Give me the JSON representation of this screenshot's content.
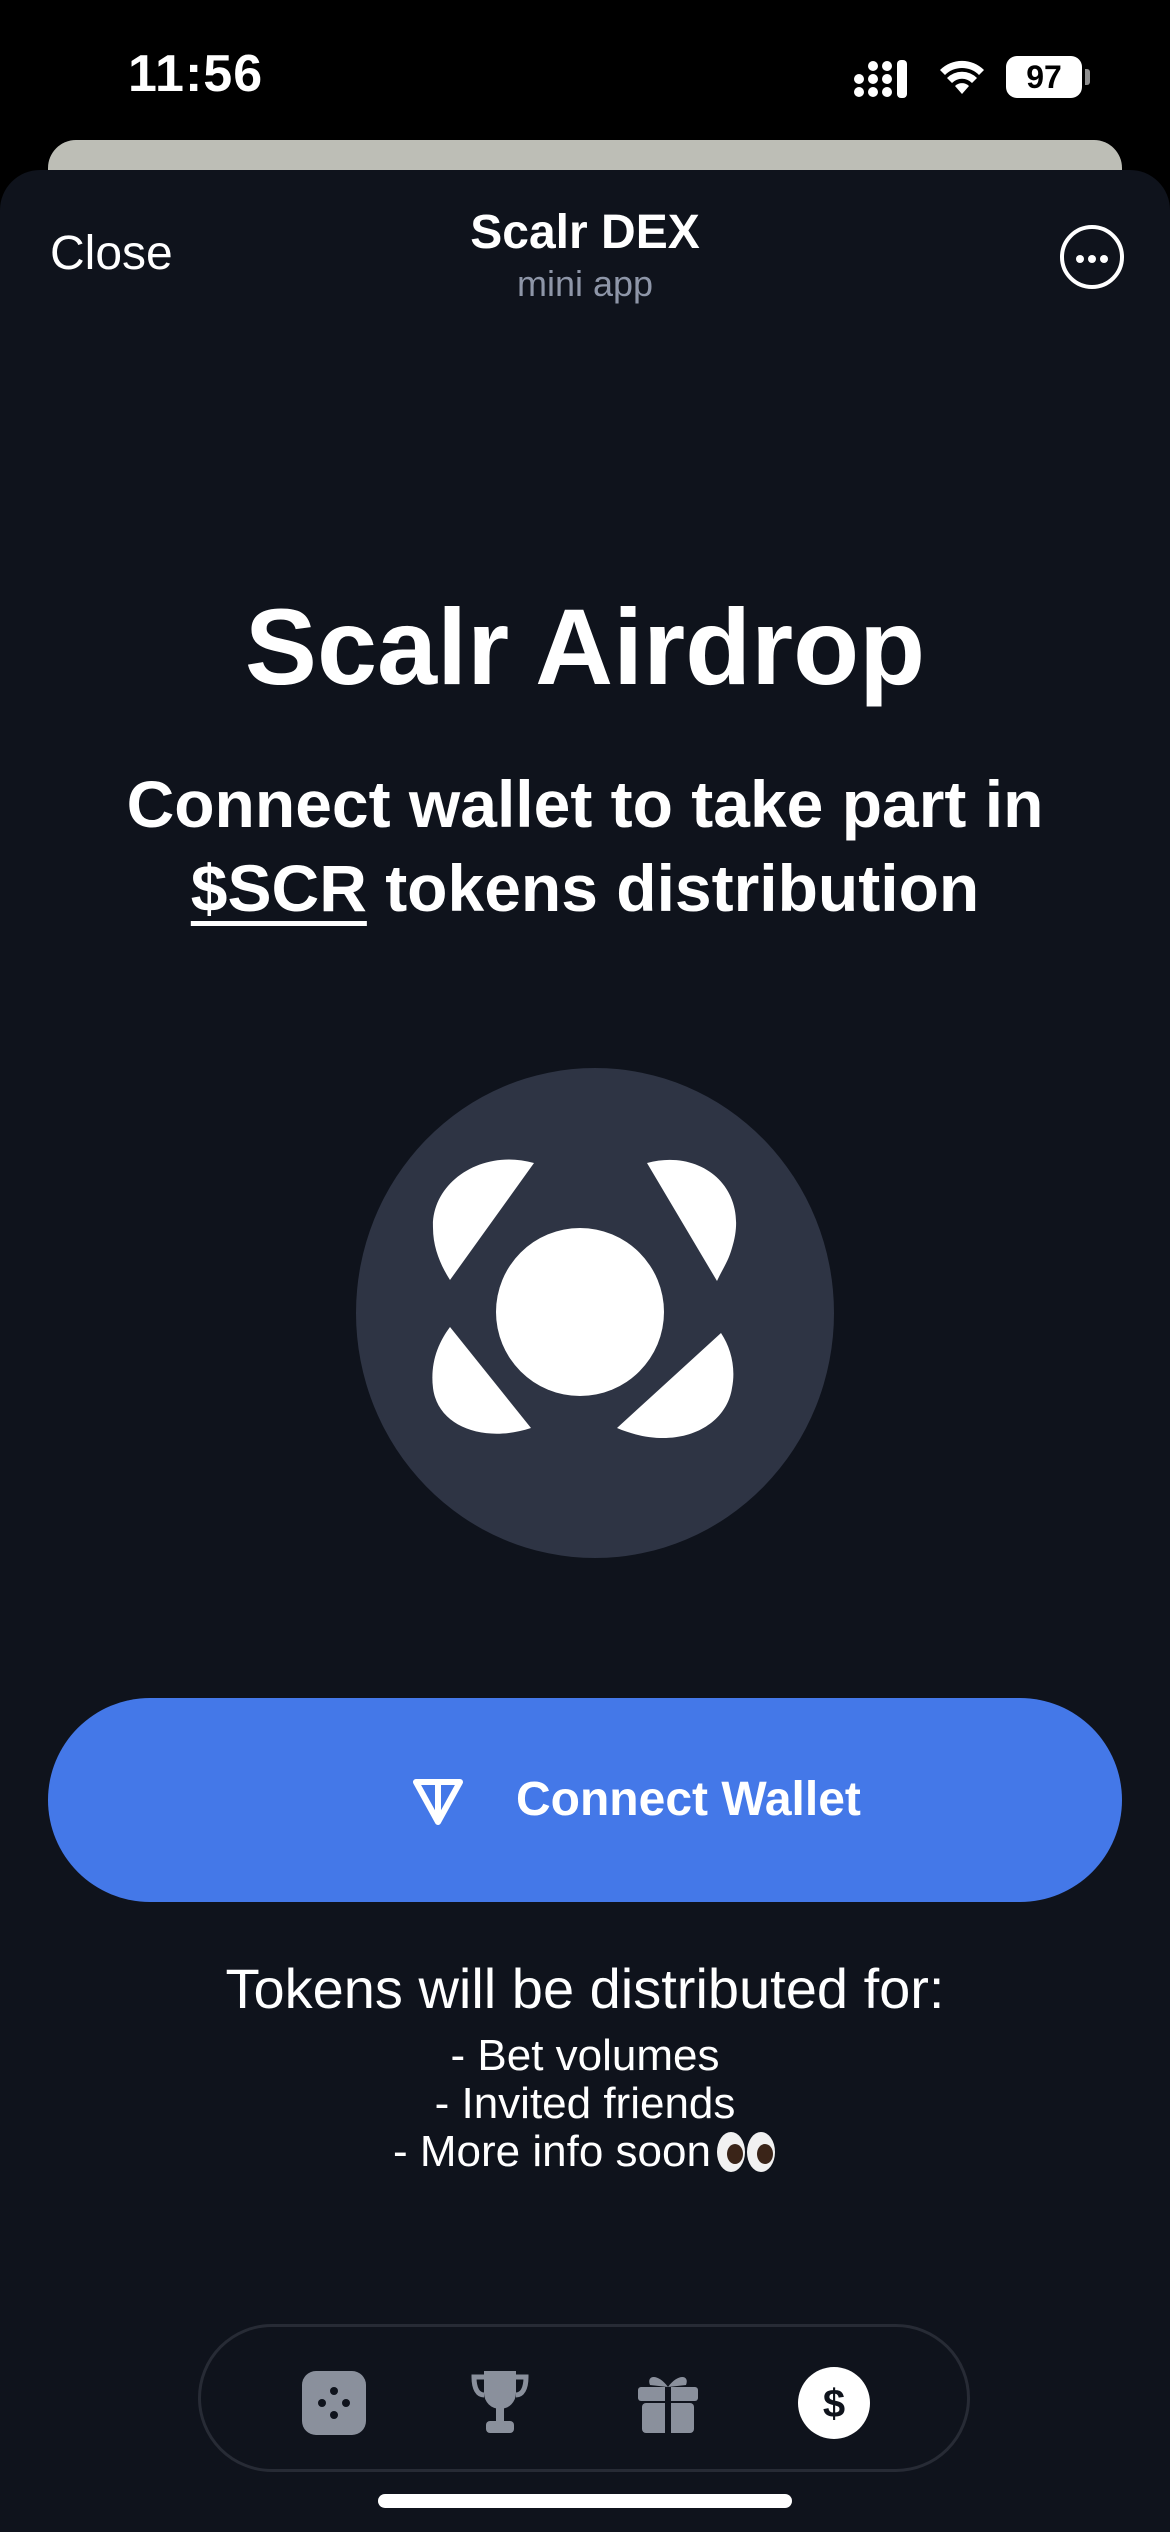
{
  "status_bar": {
    "time": "11:56",
    "battery": "97"
  },
  "header": {
    "close_label": "Close",
    "title": "Scalr DEX",
    "subtitle": "mini app"
  },
  "main": {
    "headline": "Scalr Airdrop",
    "subhead_line1": "Connect wallet to take part in",
    "token_link": "$SCR",
    "subhead_line2_rest": " tokens distribution",
    "connect_button_label": "Connect Wallet",
    "distribution_title": "Tokens will be distributed for:",
    "distribution_items": [
      "- Bet volumes",
      "- Invited friends",
      "- More info soon"
    ]
  },
  "tabbar": {
    "items": [
      {
        "icon": "dice-icon",
        "active": false
      },
      {
        "icon": "trophy-icon",
        "active": false
      },
      {
        "icon": "gift-icon",
        "active": false
      },
      {
        "icon": "dollar-icon",
        "active": true,
        "label": "$"
      }
    ]
  },
  "colors": {
    "background": "#0f131c",
    "accent": "#4478e8",
    "logo_circle": "#2e3444",
    "muted_text": "#8e96a8"
  }
}
